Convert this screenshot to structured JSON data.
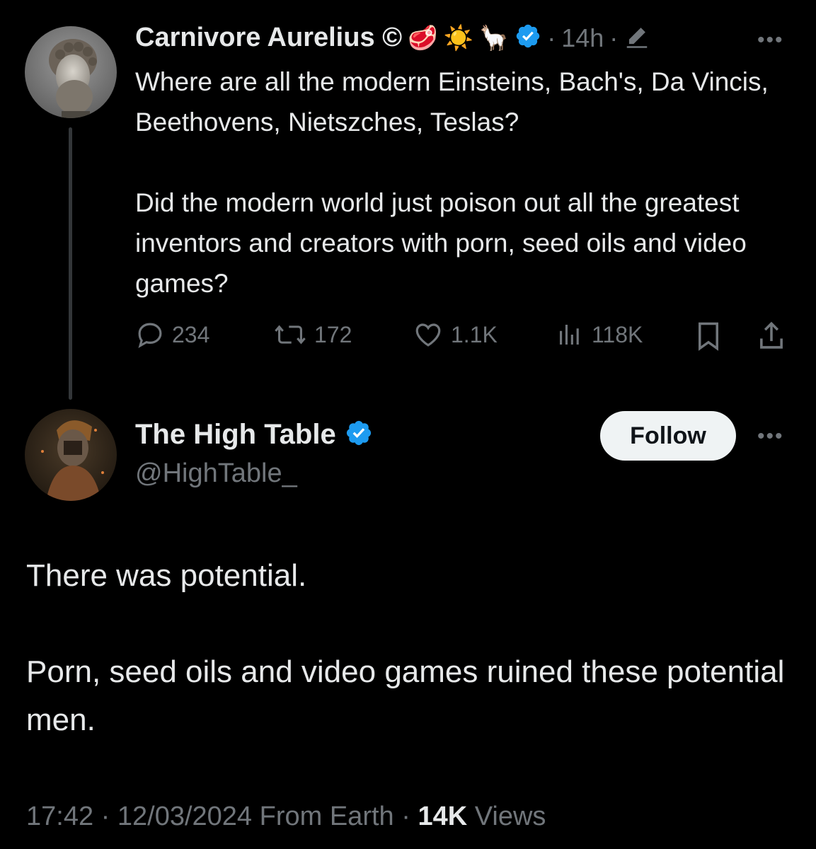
{
  "original_tweet": {
    "display_name": "Carnivore Aurelius ©",
    "emojis": [
      "🥩",
      "☀️",
      "🦙"
    ],
    "verified": true,
    "separator1": "·",
    "time": "14h",
    "separator2": "·",
    "text": "Where are all the modern Einsteins, Bach's, Da Vincis, Beethovens, Nietszches, Teslas?\n\nDid the modern world just poison out all the greatest inventors and creators with porn, seed oils and video games?",
    "actions": {
      "replies": "234",
      "reposts": "172",
      "likes": "1.1K",
      "views": "118K"
    }
  },
  "reply_tweet": {
    "display_name": "The High Table",
    "handle": "@HighTable_",
    "verified": true,
    "follow_label": "Follow",
    "text": "There was potential.\n\nPorn, seed oils and video games ruined these potential men.",
    "footer": {
      "time": "17:42",
      "sep1": "·",
      "date": "12/03/2024",
      "source": "From Earth",
      "sep2": "·",
      "views_count": "14K",
      "views_label": "Views"
    }
  },
  "colors": {
    "background": "#000000",
    "text": "#e7e9ea",
    "secondary": "#71767b",
    "verified_blue": "#1d9bf0",
    "thread_line": "#333639"
  }
}
